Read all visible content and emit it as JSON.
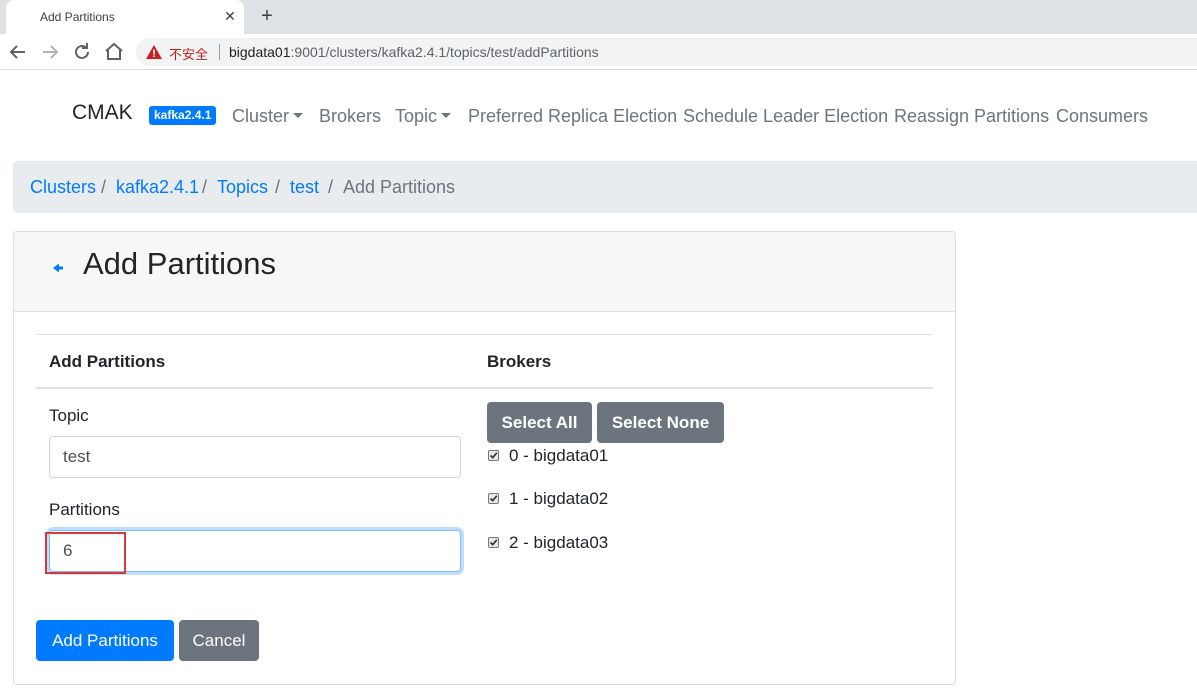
{
  "browser": {
    "tab_title": "Add Partitions",
    "close_glyph": "✕",
    "new_tab_glyph": "+",
    "security_label": "不安全",
    "url_host": "bigdata01",
    "url_path": ":9001/clusters/kafka2.4.1/topics/test/addPartitions"
  },
  "navbar": {
    "brand": "CMAK",
    "cluster_badge": "kafka2.4.1",
    "items": [
      {
        "label": "Cluster",
        "dropdown": true
      },
      {
        "label": "Brokers",
        "dropdown": false
      },
      {
        "label": "Topic",
        "dropdown": true
      },
      {
        "label": "Preferred Replica Election",
        "dropdown": false
      },
      {
        "label": "Schedule Leader Election",
        "dropdown": false
      },
      {
        "label": "Reassign Partitions",
        "dropdown": false
      },
      {
        "label": "Consumers",
        "dropdown": false
      }
    ]
  },
  "breadcrumb": {
    "separator": "/",
    "items": [
      "Clusters",
      "kafka2.4.1",
      "Topics",
      "test",
      "Add Partitions"
    ]
  },
  "card": {
    "title": "Add Partitions",
    "back_icon": "back-arrow-icon",
    "col_left": "Add Partitions",
    "col_right": "Brokers",
    "topic_label": "Topic",
    "topic_value": "test",
    "partitions_label": "Partitions",
    "partitions_value": "6",
    "select_all": "Select All",
    "select_none": "Select None",
    "brokers": [
      {
        "label": "0 - bigdata01",
        "checked": true
      },
      {
        "label": "1 - bigdata02",
        "checked": true
      },
      {
        "label": "2 - bigdata03",
        "checked": true
      }
    ],
    "submit": "Add Partitions",
    "cancel": "Cancel"
  },
  "colors": {
    "primary": "#007bff",
    "secondary": "#6c757d",
    "highlight": "#d9383a"
  }
}
